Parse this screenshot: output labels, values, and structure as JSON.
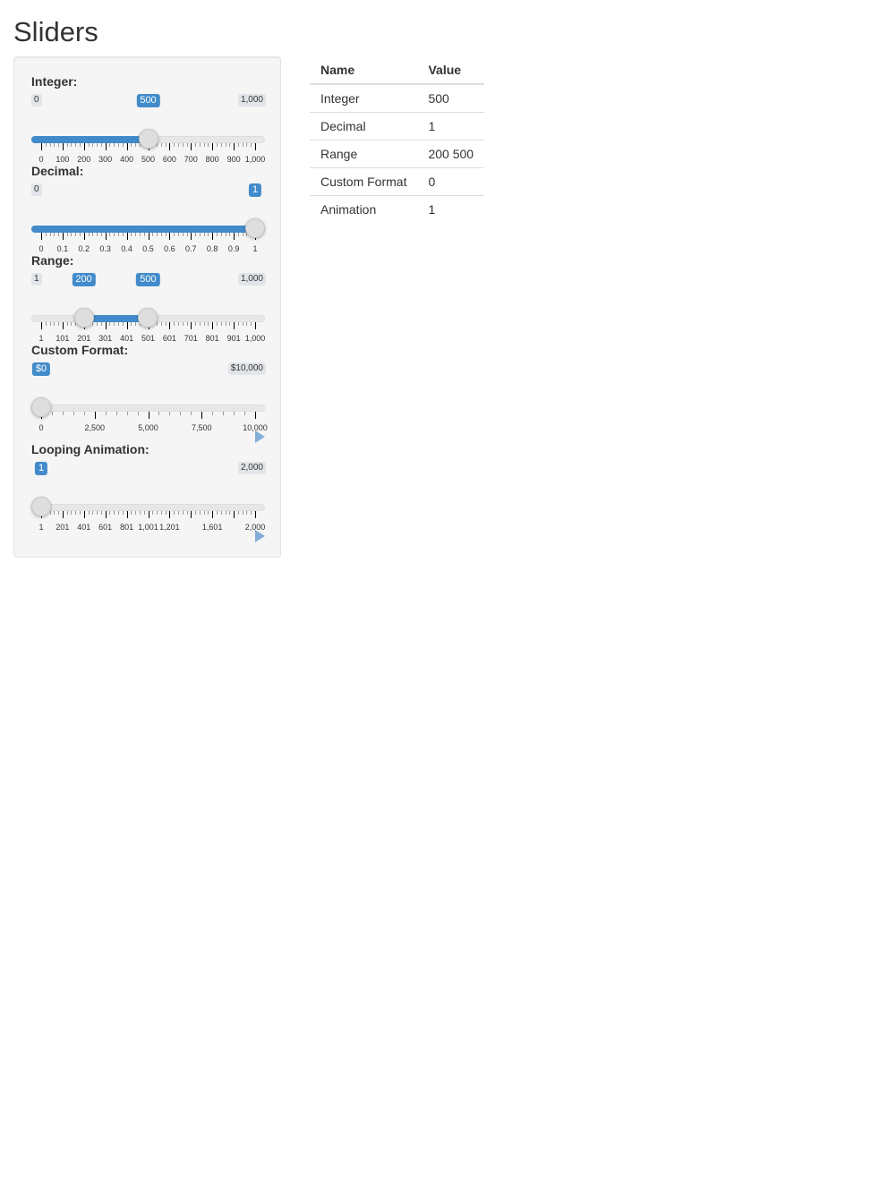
{
  "page": {
    "title": "Sliders"
  },
  "sliders": [
    {
      "label": "Integer:",
      "min_label": "0",
      "max_label": "1,000",
      "handles": [
        {
          "value_label": "500",
          "fraction": 0.5
        }
      ],
      "fill": [
        0,
        0.5
      ],
      "ticks": [
        "0",
        "100",
        "200",
        "300",
        "400",
        "500",
        "600",
        "700",
        "800",
        "900",
        "1,000"
      ],
      "minor_per_major": 5,
      "play_icon": ""
    },
    {
      "label": "Decimal:",
      "min_label": "0",
      "max_label": "",
      "handles": [
        {
          "value_label": "1",
          "fraction": 1.0
        }
      ],
      "fill": [
        0,
        1.0
      ],
      "ticks": [
        "0",
        "0.1",
        "0.2",
        "0.3",
        "0.4",
        "0.5",
        "0.6",
        "0.7",
        "0.8",
        "0.9",
        "1"
      ],
      "minor_per_major": 5,
      "play_icon": ""
    },
    {
      "label": "Range:",
      "min_label": "1",
      "max_label": "1,000",
      "handles": [
        {
          "value_label": "200",
          "fraction": 0.1992
        },
        {
          "value_label": "500",
          "fraction": 0.4995
        }
      ],
      "fill": [
        0.1992,
        0.4995
      ],
      "ticks": [
        "1",
        "101",
        "201",
        "301",
        "401",
        "501",
        "601",
        "701",
        "801",
        "901",
        "1,000"
      ],
      "minor_per_major": 5,
      "play_icon": ""
    },
    {
      "label": "Custom Format:",
      "min_label": "",
      "max_label": "$10,000",
      "handles": [
        {
          "value_label": "$0",
          "fraction": 0
        }
      ],
      "fill": null,
      "ticks": [
        "0",
        "2,500",
        "5,000",
        "7,500",
        "10,000"
      ],
      "minor_per_major": 5,
      "play_icon": "play-icon"
    },
    {
      "label": "Looping Animation:",
      "min_label": "",
      "max_label": "2,000",
      "handles": [
        {
          "value_label": "1",
          "fraction": 0
        }
      ],
      "fill": null,
      "ticks": [
        "1",
        "201",
        "401",
        "601",
        "801",
        "1,001",
        "1,201",
        "",
        "1,601",
        "",
        "2,000"
      ],
      "minor_per_major": 5,
      "play_icon": "play-icon"
    }
  ],
  "table": {
    "headers": [
      "Name",
      "Value"
    ],
    "rows": [
      [
        "Integer",
        "500"
      ],
      [
        "Decimal",
        "1"
      ],
      [
        "Range",
        "200 500"
      ],
      [
        "Custom Format",
        "0"
      ],
      [
        "Animation",
        "1"
      ]
    ]
  },
  "colors": {
    "accent": "#428bca",
    "play": "#82aed8",
    "well_bg": "#f5f5f5"
  }
}
